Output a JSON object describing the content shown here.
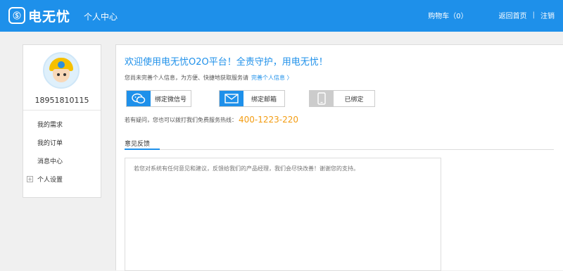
{
  "header": {
    "logo_text": "电无忧",
    "logo_mark": "Ⓢ",
    "subtitle": "个人中心",
    "cart": "购物车（0）",
    "home": "返回首页",
    "separator": "|",
    "logout": "注销"
  },
  "sidebar": {
    "phone": "18951810115",
    "items": [
      {
        "label": "我的需求"
      },
      {
        "label": "我的订单"
      },
      {
        "label": "消息中心"
      },
      {
        "label": "个人设置"
      }
    ],
    "expand_symbol": "+"
  },
  "main": {
    "welcome": "欢迎使用电无忧O2O平台！全责守护，用电无忧！",
    "info_text": "您尚未完善个人信息，为方便、快捷地获取服务请",
    "info_link": "完善个人信息 〉",
    "bind_buttons": [
      {
        "label": "绑定微信号",
        "icon": "wechat-icon"
      },
      {
        "label": "绑定邮箱",
        "icon": "mail-icon"
      },
      {
        "label": "已绑定",
        "icon": "phone-icon"
      }
    ],
    "hotline_text": "若有疑问，您也可以拨打我们免费服务热线：",
    "hotline_number": "400-1223-220",
    "tab_label": "意见反馈",
    "feedback_placeholder": "若您对系统有任何意见和建议，反馈给我们的产品经理，我们会尽快改善！谢谢您的支持。"
  },
  "colors": {
    "primary": "#1e90ea",
    "accent": "#f39c12",
    "bound_gray": "#cccccc"
  }
}
